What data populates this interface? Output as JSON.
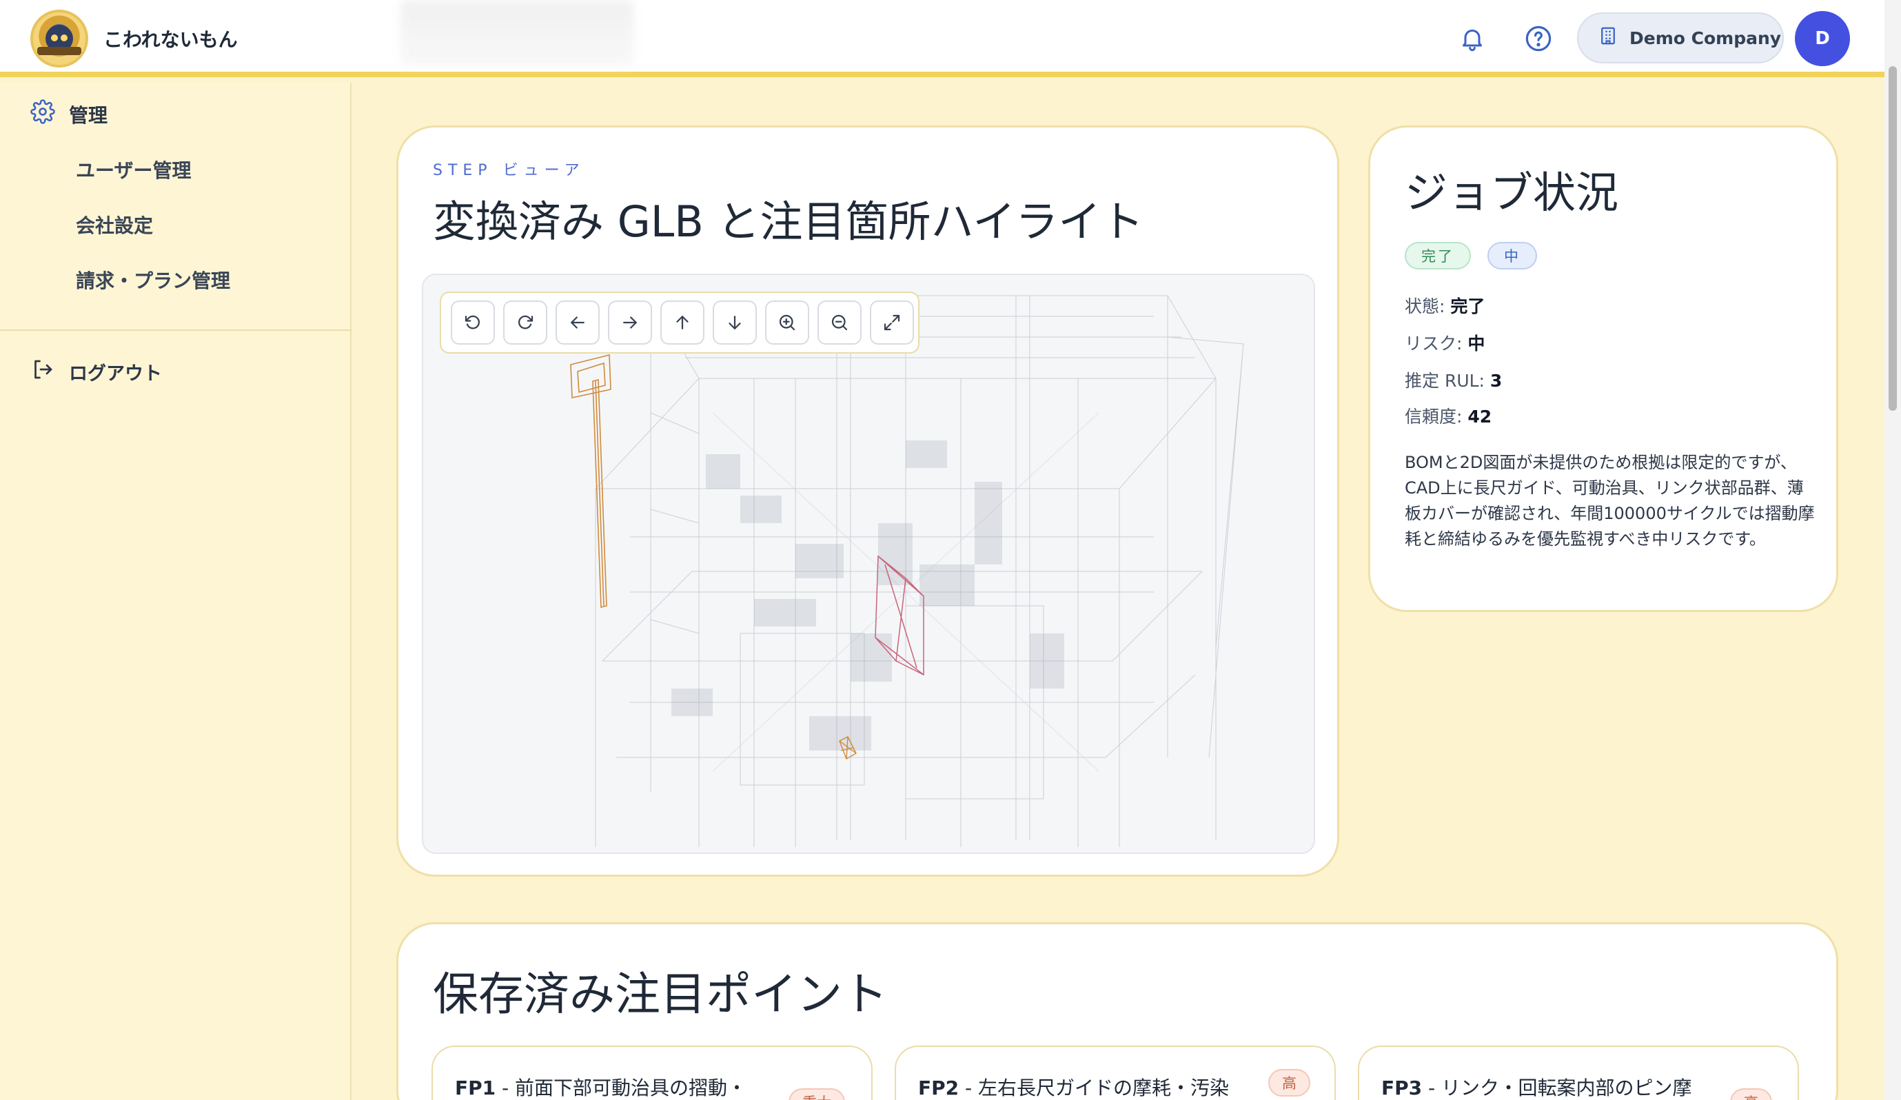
{
  "header": {
    "app_name": "こわれないもん",
    "company_name": "Demo Company",
    "avatar_initial": "D"
  },
  "sidebar": {
    "section_label": "管理",
    "items": [
      {
        "label": "ユーザー管理"
      },
      {
        "label": "会社設定"
      },
      {
        "label": "請求・プラン管理"
      }
    ],
    "logout_label": "ログアウト"
  },
  "viewer": {
    "step_label": "STEP ビューア",
    "title": "変換済み GLB と注目箇所ハイライト",
    "toolbar": [
      "rotate-left",
      "rotate-right",
      "pan-left",
      "pan-right",
      "pan-up",
      "pan-down",
      "zoom-in",
      "zoom-out",
      "fullscreen"
    ]
  },
  "status": {
    "title": "ジョブ状況",
    "badge_status": "完了",
    "badge_risk": "中",
    "state_key": "状態:",
    "state_value": "完了",
    "risk_key": "リスク:",
    "risk_value": "中",
    "rul_key": "推定 RUL:",
    "rul_value": "3",
    "confidence_key": "信頼度:",
    "confidence_value": "42",
    "summary": "BOMと2D図面が未提供のため根拠は限定的ですが、CAD上に長尺ガイド、可動治具、リンク状部品群、薄板カバーが確認され、年間100000サイクルでは摺動摩耗と締結ゆるみを優先監視すべき中リスクです。"
  },
  "focus_points": {
    "title": "保存済み注目ポイント",
    "items": [
      {
        "id": "FP1",
        "text": "- 前面下部可動治具の摺動・",
        "severity": "重大"
      },
      {
        "id": "FP2",
        "text": "- 左右長尺ガイドの摩耗・汚染",
        "severity": "高"
      },
      {
        "id": "FP3",
        "text": "- リンク・回転案内部のピン摩",
        "severity": "高"
      }
    ]
  },
  "colors": {
    "accent": "#f2d35a",
    "avatar": "#4450e0",
    "highlight_orange": "#d08a3a",
    "highlight_red": "#c8647a"
  }
}
